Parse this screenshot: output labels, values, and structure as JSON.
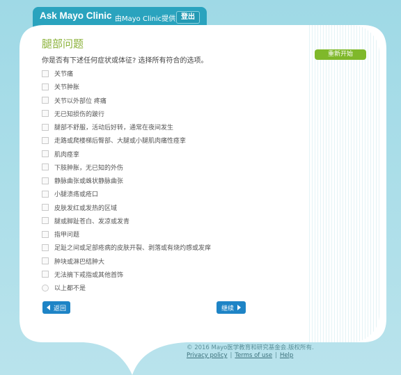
{
  "header": {
    "brand": "Ask Mayo Clinic",
    "provided_by": "由Mayo Clinic提供",
    "logout_label": "登出"
  },
  "main": {
    "title": "腿部问题",
    "question": "你是否有下述任何症状或体征? 选择所有符合的选项。",
    "options": [
      {
        "label": "关节痛",
        "control": "checkbox"
      },
      {
        "label": "关节肿胀",
        "control": "checkbox"
      },
      {
        "label": "关节以外部位 疼痛",
        "control": "checkbox"
      },
      {
        "label": "无已知损伤的跛行",
        "control": "checkbox"
      },
      {
        "label": "腿部不舒服，活动后好转，通常在夜间发生",
        "control": "checkbox"
      },
      {
        "label": "走路或爬楼梯后臀部、大腿或小腿肌肉痛性痉挛",
        "control": "checkbox"
      },
      {
        "label": "肌肉痉挛",
        "control": "checkbox"
      },
      {
        "label": "下肢肿胀，无已知的外伤",
        "control": "checkbox"
      },
      {
        "label": "静脉曲张或蛛状静脉曲张",
        "control": "checkbox"
      },
      {
        "label": "小腿溃疡或疮口",
        "control": "checkbox"
      },
      {
        "label": "皮肤发红或发热的区域",
        "control": "checkbox"
      },
      {
        "label": "腿或脚趾苍白、发凉或发青",
        "control": "checkbox"
      },
      {
        "label": "指甲问题",
        "control": "checkbox"
      },
      {
        "label": "足趾之间或足部疮病的皮肤开裂、剥落或有烧灼感或发痒",
        "control": "checkbox"
      },
      {
        "label": "肿块或淋巴结肿大",
        "control": "checkbox"
      },
      {
        "label": "无法摘下戒指或其他首饰",
        "control": "checkbox"
      },
      {
        "label": "以上都不是",
        "control": "radio"
      }
    ]
  },
  "sidebar": {
    "restart_label": "重新开始"
  },
  "nav": {
    "back_label": "返回",
    "next_label": "继续"
  },
  "footer": {
    "copyright": "© 2016 Mayo医学教育和研究基金会.版权所有.",
    "links": [
      "Privacy policy",
      "Terms of use",
      "Help"
    ]
  },
  "colors": {
    "header_bg": "#2aa3be",
    "title_green": "#8bb23a",
    "restart_green": "#7fb82a",
    "nav_blue": "#1e84c6",
    "page_bg": "#a9dde8"
  }
}
